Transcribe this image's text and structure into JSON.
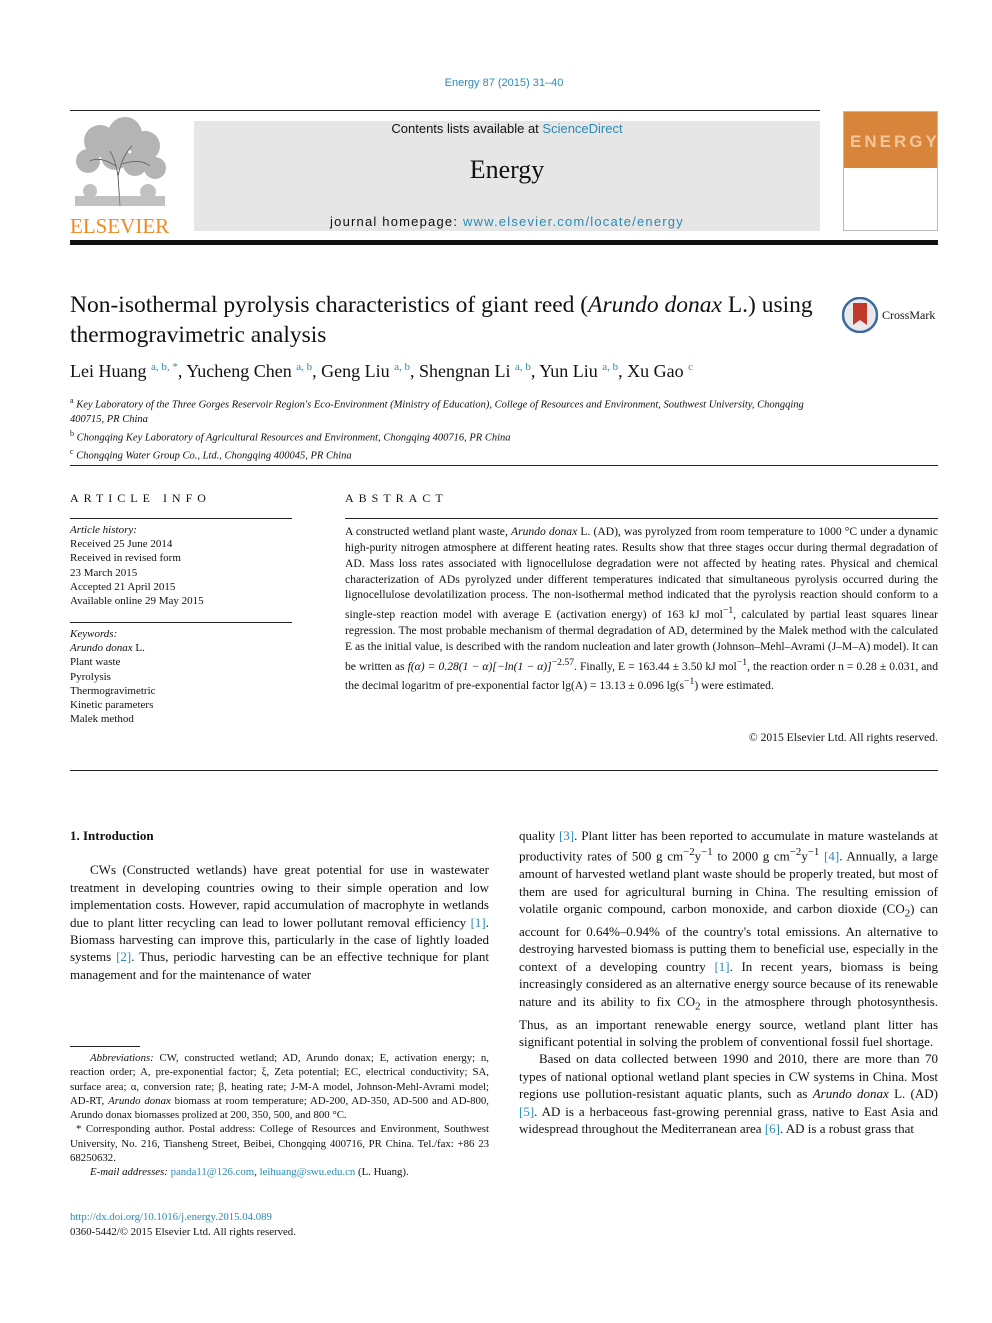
{
  "header": {
    "citation": "Energy 87 (2015) 31–40",
    "contents_prefix": "Contents lists available at ",
    "contents_link": "ScienceDirect",
    "journal_name": "Energy",
    "homepage_prefix": "journal homepage: ",
    "homepage_link": "www.elsevier.com/locate/energy",
    "publisher_logo_text": "ELSEVIER",
    "cover_text": "ENERGY"
  },
  "article": {
    "title_part1": "Non-isothermal pyrolysis characteristics of giant reed (",
    "title_italic": "Arundo donax",
    "title_part2": " L.) using thermogravimetric analysis",
    "crossmark_label": "CrossMark",
    "authors": [
      {
        "name": "Lei Huang",
        "sup": "a, b, *"
      },
      {
        "name": "Yucheng Chen",
        "sup": "a, b"
      },
      {
        "name": "Geng Liu",
        "sup": "a, b"
      },
      {
        "name": "Shengnan Li",
        "sup": "a, b"
      },
      {
        "name": "Yun Liu",
        "sup": "a, b"
      },
      {
        "name": "Xu Gao",
        "sup": "c"
      }
    ],
    "affiliations": [
      {
        "key": "a",
        "text": "Key Laboratory of the Three Gorges Reservoir Region's Eco-Environment (Ministry of Education), College of Resources and Environment, Southwest University, Chongqing 400715, PR China"
      },
      {
        "key": "b",
        "text": "Chongqing Key Laboratory of Agricultural Resources and Environment, Chongqing 400716, PR China"
      },
      {
        "key": "c",
        "text": "Chongqing Water Group Co., Ltd., Chongqing 400045, PR China"
      }
    ]
  },
  "article_info": {
    "heading": "ARTICLE INFO",
    "history_label": "Article history:",
    "history": [
      "Received 25 June 2014",
      "Received in revised form",
      "23 March 2015",
      "Accepted 21 April 2015",
      "Available online 29 May 2015"
    ],
    "keywords_label": "Keywords:",
    "keyword_italic": "Arundo donax",
    "keyword_italic_suffix": " L.",
    "keywords": [
      "Plant waste",
      "Pyrolysis",
      "Thermogravimetric",
      "Kinetic parameters",
      "Malek method"
    ]
  },
  "abstract": {
    "heading": "ABSTRACT",
    "p1": "A constructed wetland plant waste, ",
    "p1_italic": "Arundo donax",
    "p2": " L. (AD), was pyrolyzed from room temperature to 1000 °C under a dynamic high-purity nitrogen atmosphere at different heating rates. Results show that three stages occur during thermal degradation of AD. Mass loss rates associated with lignocellulose degradation were not affected by heating rates. Physical and chemical characterization of ADs pyrolyzed under different temperatures indicated that simultaneous pyrolysis occurred during the lignocellulose devolatilization process. The non-isothermal method indicated that the pyrolysis reaction should conform to a single-step reaction model with average E (activation energy) of 163 kJ mol",
    "sup_neg1": "−1",
    "p3": ", calculated by partial least squares linear regression. The most probable mechanism of thermal degradation of AD, determined by the Malek method with the calculated E as the initial value, is described with the random nucleation and later growth (Johnson–Mehl–Avrami (J–M–A) model). It can be written as ",
    "formula": "f(α) = 0.28(1 − α)[−ln(1 − α)]",
    "formula_exp": "−2.57",
    "p4": ". Finally, E = 163.44 ± 3.50 kJ mol",
    "p5": ", the reaction order n = 0.28 ± 0.031, and the decimal logaritm of pre-exponential factor lg(A) = 13.13 ± 0.096 lg(s",
    "p6": ") were estimated.",
    "copyright": "© 2015 Elsevier Ltd. All rights reserved."
  },
  "body": {
    "section_heading": "1.  Introduction",
    "left_para": {
      "t1": "CWs (Constructed wetlands) have great potential for use in wastewater treatment in developing countries owing to their simple operation and low implementation costs. However, rapid accumulation of macrophyte in wetlands due to plant litter recycling can lead to lower pollutant removal efficiency ",
      "r1": "[1]",
      "t2": ". Biomass harvesting can improve this, particularly in the case of lightly loaded systems ",
      "r2": "[2]",
      "t3": ". Thus, periodic harvesting can be an effective technique for plant management and for the maintenance of water"
    },
    "right_para1": {
      "t1": "quality ",
      "r3": "[3]",
      "t2": ". Plant litter has been reported to accumulate in mature wastelands at productivity rates of 500 g cm",
      "s1": "−2",
      "t2b": "y",
      "s2": "−1",
      "t2c": " to 2000 g cm",
      "s3": "−2",
      "t2d": "y",
      "s4": "−1",
      "t2e": " ",
      "r4": "[4]",
      "t3": ". Annually, a large amount of harvested wetland plant waste should be properly treated, but most of them are used for agricultural burning in China. The resulting emission of volatile organic compound, carbon monoxide, and carbon dioxide (CO",
      "sub2": "2",
      "t4": ") can account for 0.64%–0.94% of the country's total emissions. An alternative to destroying harvested biomass is putting them to beneficial use, especially in the context of a developing country ",
      "r1": "[1]",
      "t5": ". In recent years, biomass is being increasingly considered as an alternative energy source because of its renewable nature and its ability to fix CO",
      "sub2b": "2",
      "t6": " in the atmosphere through photosynthesis. Thus, as an important renewable energy source, wetland plant litter has significant potential in solving the problem of conventional fossil fuel shortage."
    },
    "right_para2": {
      "t1": "Based on data collected between 1990 and 2010, there are more than 70 types of national optional wetland plant species in CW systems in China. Most regions use pollution-resistant aquatic plants, such as ",
      "italic": "Arundo donax",
      "t2": " L. (AD) ",
      "r5": "[5]",
      "t3": ". AD is a herbaceous fast-growing perennial grass, native to East Asia and widespread throughout the Mediterranean area ",
      "r6": "[6]",
      "t4": ". AD is a robust grass that"
    }
  },
  "footnotes": {
    "abbr_label": "Abbreviations:",
    "abbr_text1": " CW, constructed wetland; AD, Arundo donax; E, activation energy; n, reaction order; A, pre-exponential factor; ξ, Zeta potential; EC, electrical conductivity; SA, surface area; α, conversion rate; β, heating rate; J-M-A model, Johnson-Mehl-Avrami model; AD-RT, ",
    "abbr_italic": "Arundo donax",
    "abbr_text2": " biomass at room temperature; AD-200, AD-350, AD-500 and AD-800, Arundo donax biomasses prolized at 200, 350, 500, and 800 °C.",
    "corresponding": "* Corresponding author. Postal address: College of Resources and Environment, Southwest University, No. 216, Tiansheng Street, Beibei, Chongqing 400716, PR China. Tel./fax: +86 23 68250632.",
    "email_label": "E-mail addresses:",
    "email1": "panda11@126.com",
    "email2": "leihuang@swu.edu.cn",
    "email_suffix": " (L. Huang).",
    "doi": "http://dx.doi.org/10.1016/j.energy.2015.04.089",
    "issn": "0360-5442/© 2015 Elsevier Ltd. All rights reserved."
  }
}
